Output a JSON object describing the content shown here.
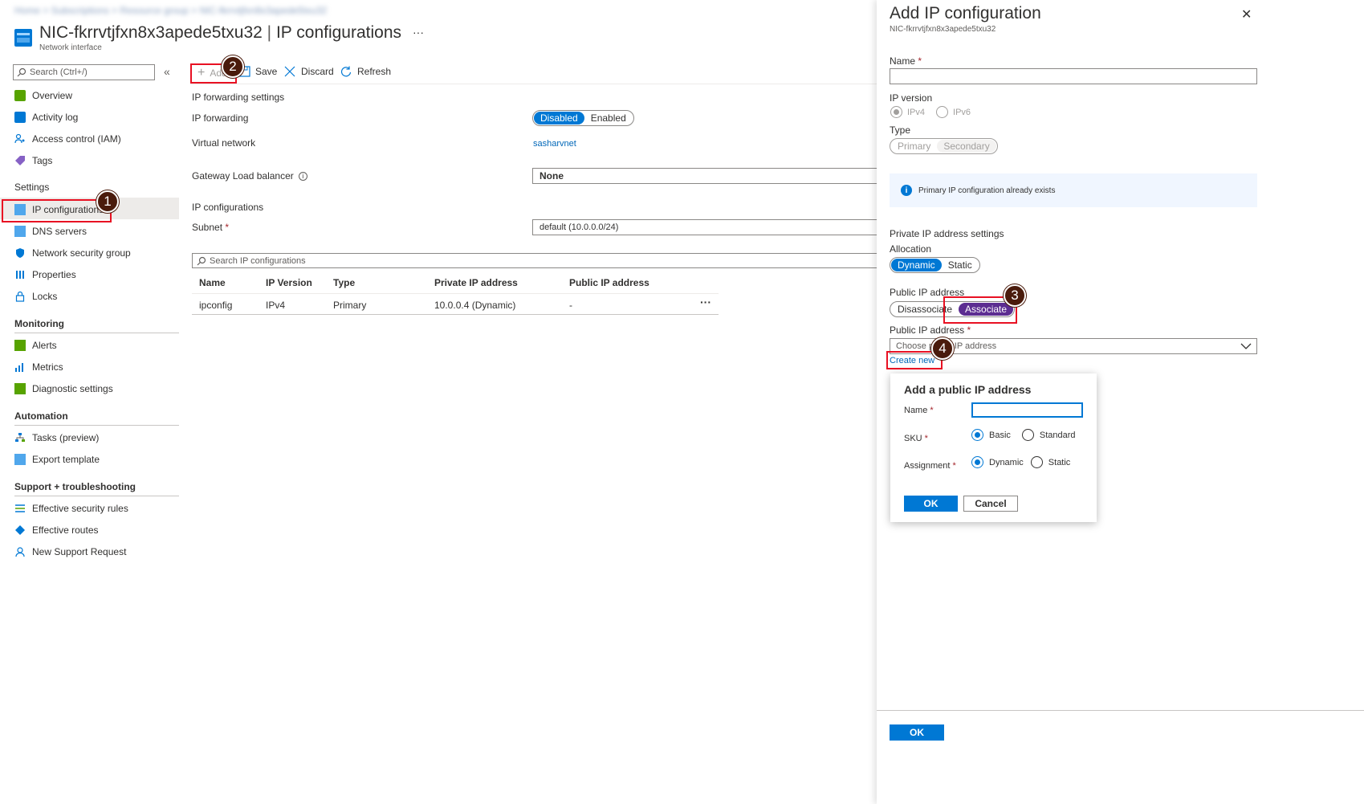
{
  "breadcrumb": "Home > Subscriptions > Resource group > NIC-fkrrvtjfxn8x3apede5txu32",
  "header": {
    "title": "NIC-fkrrvtjfxn8x3apede5txu32",
    "separator": "|",
    "section": "IP configurations",
    "subtitle": "Network interface",
    "more": "···"
  },
  "sidebar": {
    "search_placeholder": "Search (Ctrl+/)",
    "collapse": "«",
    "items": [
      {
        "label": "Overview",
        "icon": "overview-icon"
      },
      {
        "label": "Activity log",
        "icon": "activity-log-icon"
      },
      {
        "label": "Access control (IAM)",
        "icon": "iam-icon"
      },
      {
        "label": "Tags",
        "icon": "tag-icon"
      }
    ],
    "settings_heading": "Settings",
    "settings_items": [
      {
        "label": "IP configurations",
        "icon": "ip-config-icon"
      },
      {
        "label": "DNS servers",
        "icon": "dns-icon"
      },
      {
        "label": "Network security group",
        "icon": "shield-icon"
      },
      {
        "label": "Properties",
        "icon": "properties-icon"
      },
      {
        "label": "Locks",
        "icon": "lock-icon"
      }
    ],
    "monitoring_heading": "Monitoring",
    "monitoring_items": [
      {
        "label": "Alerts",
        "icon": "alert-icon"
      },
      {
        "label": "Metrics",
        "icon": "metrics-icon"
      },
      {
        "label": "Diagnostic settings",
        "icon": "diagnostic-icon"
      }
    ],
    "automation_heading": "Automation",
    "automation_items": [
      {
        "label": "Tasks (preview)",
        "icon": "tasks-icon"
      },
      {
        "label": "Export template",
        "icon": "export-icon"
      }
    ],
    "support_heading": "Support + troubleshooting",
    "support_items": [
      {
        "label": "Effective security rules",
        "icon": "security-rules-icon"
      },
      {
        "label": "Effective routes",
        "icon": "routes-icon"
      },
      {
        "label": "New Support Request",
        "icon": "support-icon"
      }
    ]
  },
  "toolbar": {
    "add": "Add",
    "save": "Save",
    "discard": "Discard",
    "refresh": "Refresh"
  },
  "main": {
    "forwarding_heading": "IP forwarding settings",
    "ip_forwarding_label": "IP forwarding",
    "ip_forwarding_options": [
      "Disabled",
      "Enabled"
    ],
    "virtual_network_label": "Virtual network",
    "virtual_network_value": "sasharvnet",
    "gateway_label": "Gateway Load balancer",
    "gateway_value": "None",
    "ipconfig_heading": "IP configurations",
    "subnet_label": "Subnet",
    "subnet_value": "default (10.0.0.0/24)",
    "table_search_placeholder": "Search IP configurations",
    "table": {
      "headers": [
        "Name",
        "IP Version",
        "Type",
        "Private IP address",
        "Public IP address"
      ],
      "rows": [
        [
          "ipconfig",
          "IPv4",
          "Primary",
          "10.0.0.4 (Dynamic)",
          "-"
        ]
      ],
      "row_menu": "···"
    }
  },
  "panel": {
    "title": "Add IP configuration",
    "subtitle": "NIC-fkrrvtjfxn8x3apede5txu32",
    "close": "✕",
    "name_label": "Name",
    "ip_version_label": "IP version",
    "ip_version_options": [
      "IPv4",
      "IPv6"
    ],
    "type_label": "Type",
    "type_options": [
      "Primary",
      "Secondary"
    ],
    "info_text": "Primary IP configuration already exists",
    "private_heading": "Private IP address settings",
    "allocation_label": "Allocation",
    "allocation_options": [
      "Dynamic",
      "Static"
    ],
    "public_ip_label": "Public IP address",
    "public_ip_options": [
      "Disassociate",
      "Associate"
    ],
    "public_ip_select_label": "Public IP address",
    "public_ip_select_placeholder": "Choose public IP address",
    "create_new": "Create new",
    "ok": "OK"
  },
  "popup": {
    "title": "Add a public IP address",
    "name_label": "Name",
    "sku_label": "SKU",
    "sku_options": [
      "Basic",
      "Standard"
    ],
    "assignment_label": "Assignment",
    "assignment_options": [
      "Dynamic",
      "Static"
    ],
    "ok": "OK",
    "cancel": "Cancel"
  },
  "callouts": [
    "1",
    "2",
    "3",
    "4"
  ],
  "colors": {
    "accent": "#0078d4",
    "associate": "#5c2d91",
    "callout": "#4a1b0c",
    "highlight": "#e81123"
  }
}
